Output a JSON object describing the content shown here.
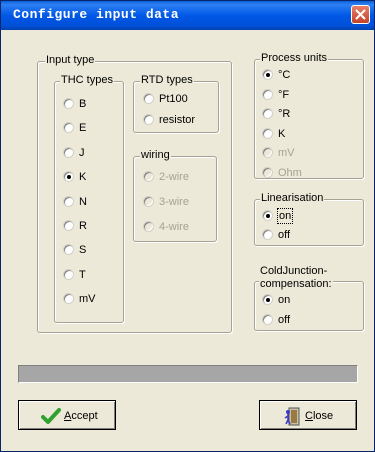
{
  "window": {
    "title": "Configure input data"
  },
  "input_type": {
    "legend": "Input type",
    "thc": {
      "legend": "THC types",
      "items": [
        {
          "label": "B",
          "selected": false
        },
        {
          "label": "E",
          "selected": false
        },
        {
          "label": "J",
          "selected": false
        },
        {
          "label": "K",
          "selected": true
        },
        {
          "label": "N",
          "selected": false
        },
        {
          "label": "R",
          "selected": false
        },
        {
          "label": "S",
          "selected": false
        },
        {
          "label": "T",
          "selected": false
        },
        {
          "label": "mV",
          "selected": false
        }
      ]
    },
    "rtd": {
      "legend": "RTD types",
      "items": [
        {
          "label": "Pt100",
          "selected": false
        },
        {
          "label": "resistor",
          "selected": false
        }
      ]
    },
    "wiring": {
      "legend": "wiring",
      "items": [
        {
          "label": "2-wire",
          "selected": false,
          "disabled": true
        },
        {
          "label": "3-wire",
          "selected": false,
          "disabled": true
        },
        {
          "label": "4-wire",
          "selected": false,
          "disabled": true
        }
      ]
    }
  },
  "process_units": {
    "legend": "Process units",
    "items": [
      {
        "label": "°C",
        "selected": true
      },
      {
        "label": "°F",
        "selected": false
      },
      {
        "label": "°R",
        "selected": false
      },
      {
        "label": "K",
        "selected": false
      },
      {
        "label": "mV",
        "selected": false,
        "disabled": true
      },
      {
        "label": "Ohm",
        "selected": false,
        "disabled": true
      }
    ]
  },
  "linearisation": {
    "legend": "Linearisation",
    "items": [
      {
        "label": "on",
        "selected": true
      },
      {
        "label": "off",
        "selected": false
      }
    ]
  },
  "cold_junction": {
    "legend_line1": "ColdJunction-",
    "legend_line2": "compensation:",
    "items": [
      {
        "label": "on",
        "selected": true
      },
      {
        "label": "off",
        "selected": false
      }
    ]
  },
  "progress": {
    "value": 0
  },
  "buttons": {
    "accept_label": "Accept",
    "accept_mnemonic": "A",
    "accept_rest": "ccept",
    "close_label": "Close",
    "close_mnemonic": "C",
    "close_rest": "lose"
  },
  "colors": {
    "title_bar": "#0058e6",
    "dialog_bg": "#ece9d8",
    "accept_check": "#2fa12f",
    "disabled_text": "#a6a295"
  }
}
